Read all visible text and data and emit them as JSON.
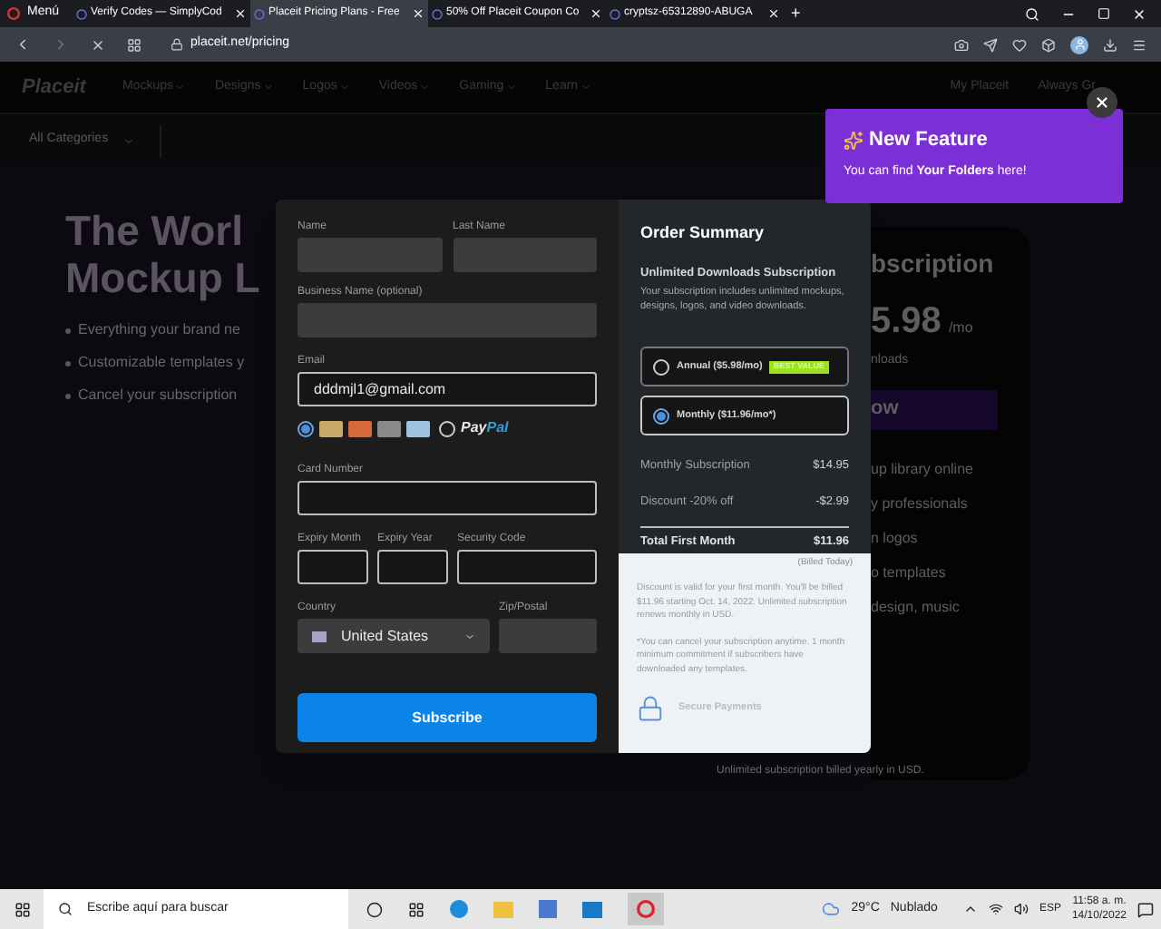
{
  "browser": {
    "menu": "Menú",
    "tabs": [
      {
        "title": "Verify Codes — SimplyCod",
        "selected": false
      },
      {
        "title": "Placeit Pricing Plans - Free",
        "selected": true
      },
      {
        "title": "50% Off Placeit Coupon Co",
        "selected": false
      },
      {
        "title": "cryptsz-65312890-ABUGA",
        "selected": false
      }
    ],
    "new_tab": "+",
    "address": "placeit.net/pricing"
  },
  "nav": {
    "logo": "Placeit",
    "items": [
      "Mockups",
      "Designs",
      "Logos",
      "Videos",
      "Gaming",
      "Learn"
    ],
    "right": [
      "My Placeit",
      "Always Gr"
    ]
  },
  "category": {
    "dropdown": "All Categories"
  },
  "popup": {
    "title": "New Feature",
    "text": "You can find **Your Folders** here!"
  },
  "hero": {
    "title_lines": [
      "The Worl",
      "Mockup L"
    ],
    "bullets": [
      "Everything your brand ne",
      "Customizable templates y",
      "Cancel your subscription"
    ]
  },
  "plan_card": {
    "heading": "bscription",
    "price": "5.98",
    "unit": "/mo",
    "subtitle": "nloads",
    "button": "ow",
    "features": [
      "up library online",
      "y professionals",
      "n logos",
      "o templates",
      "design, music"
    ],
    "footer": "Unlimited subscription billed yearly in USD."
  },
  "form": {
    "name": {
      "label": "Name"
    },
    "last_name": {
      "label": "Last Name"
    },
    "business": {
      "label": "Business Name (optional)"
    },
    "email": {
      "label": "Email",
      "value": "dddmjl1@gmail.com"
    },
    "payment_methods": [
      {
        "kind": "cards",
        "selected": true
      },
      {
        "kind": "paypal",
        "selected": false,
        "label_a": "Pay",
        "label_b": "Pal"
      }
    ],
    "card_number": {
      "label": "Card Number"
    },
    "expiry_month": {
      "label": "Expiry Month"
    },
    "expiry_year": {
      "label": "Expiry Year"
    },
    "security_code": {
      "label": "Security Code"
    },
    "country": {
      "label": "Country",
      "value": "United States"
    },
    "zip": {
      "label": "Zip/Postal"
    },
    "submit": "Subscribe"
  },
  "summary": {
    "title": "Order Summary",
    "subtitle": "Unlimited Downloads Subscription",
    "description": "Your subscription includes unlimited mockups, designs, logos, and video downloads.",
    "plans": [
      {
        "label": "Annual ($5.98/mo)",
        "badge": "BEST VALUE",
        "selected": false
      },
      {
        "label": "Monthly ($11.96/mo*)",
        "selected": true
      }
    ],
    "lines": [
      {
        "label": "Monthly Subscription",
        "amount": "$14.95"
      },
      {
        "label": "Discount -20% off",
        "amount": "-$2.99"
      }
    ],
    "total": {
      "label": "Total First Month",
      "amount": "$11.96",
      "note": "(Billed Today)"
    },
    "notes": [
      "Discount is valid for your first month. You'll be billed $11.96 starting Oct. 14, 2022. Unlimited subscription renews monthly in USD.",
      "*You can cancel your subscription anytime. 1 month minimum commitment if subscribers have downloaded any templates."
    ],
    "secure": "Secure Payments"
  },
  "taskbar": {
    "search": "Escribe aquí para buscar",
    "weather": "29°C",
    "condition": "Nublado",
    "lang": "ESP",
    "time": "11:58 a. m.",
    "date": "14/10/2022"
  }
}
